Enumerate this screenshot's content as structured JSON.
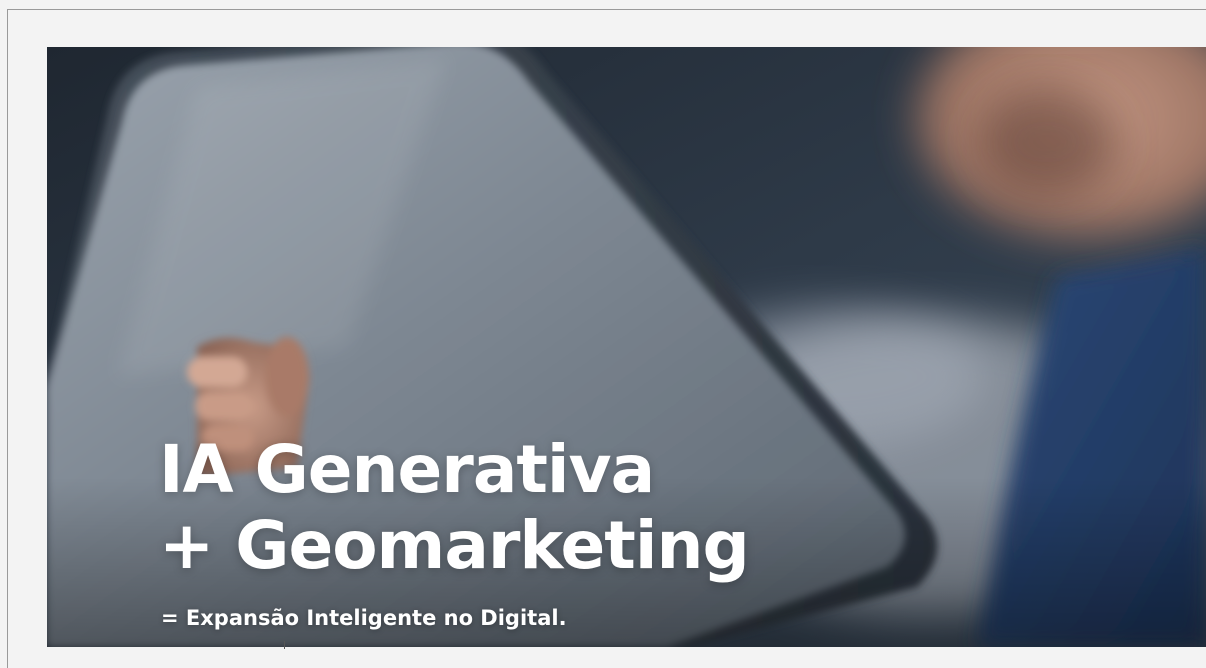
{
  "video": {
    "headline_line1": "IA Generativa",
    "headline_line2": "+ Geomarketing",
    "subline": "= Expansão Inteligente no Digital."
  },
  "colors": {
    "page_background": "#f3f3f3",
    "frame_border": "#9a9a9a",
    "overlay_text": "#ffffff"
  }
}
